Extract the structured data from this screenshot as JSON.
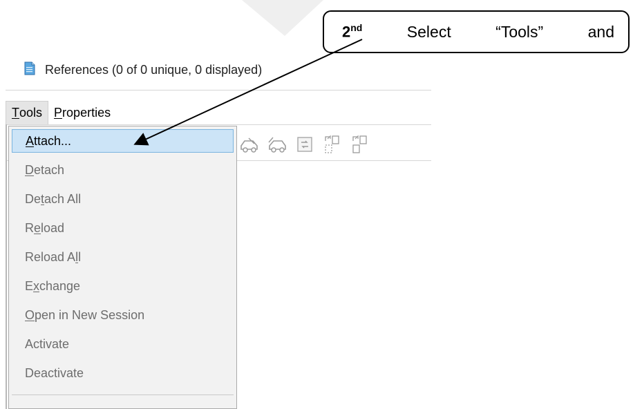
{
  "window": {
    "title": "References (0 of 0 unique, 0 displayed)",
    "icon": "document-icon"
  },
  "annotation": {
    "number": "2",
    "superscript": "nd",
    "words": [
      "Select",
      "“Tools”",
      "and"
    ]
  },
  "menubar": {
    "items": [
      {
        "prefix": "",
        "mnemonic": "T",
        "rest": "ools"
      },
      {
        "prefix": "",
        "mnemonic": "P",
        "rest": "roperties"
      }
    ]
  },
  "toolbar": {
    "icons": [
      "attach-car-icon",
      "detach-car-icon",
      "exchange-icon",
      "open-new-icon",
      "activate-icon"
    ]
  },
  "dropdown": {
    "items": [
      {
        "prefix": "",
        "mnemonic": "A",
        "rest": "ttach...",
        "state": "selected"
      },
      {
        "prefix": "",
        "mnemonic": "D",
        "rest": "etach",
        "state": "disabled"
      },
      {
        "prefix": "De",
        "mnemonic": "t",
        "rest": "ach All",
        "state": "disabled"
      },
      {
        "prefix": "R",
        "mnemonic": "e",
        "rest": "load",
        "state": "disabled"
      },
      {
        "prefix": "Reload A",
        "mnemonic": "l",
        "rest": "l",
        "state": "disabled"
      },
      {
        "prefix": "E",
        "mnemonic": "x",
        "rest": "change",
        "state": "disabled"
      },
      {
        "prefix": "",
        "mnemonic": "O",
        "rest": "pen in New Session",
        "state": "disabled"
      },
      {
        "prefix": "",
        "mnemonic": "",
        "rest": "Activate",
        "state": "disabled"
      },
      {
        "prefix": "",
        "mnemonic": "",
        "rest": "Deactivate",
        "state": "disabled"
      }
    ]
  }
}
